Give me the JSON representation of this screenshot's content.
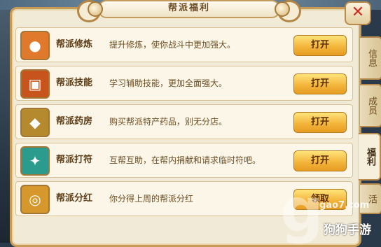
{
  "window": {
    "title": "帮派福利",
    "close_label": "✕"
  },
  "tabs": [
    {
      "label": "信息",
      "active": false
    },
    {
      "label": "成员",
      "active": false
    },
    {
      "label": "福利",
      "active": true
    },
    {
      "label": "活",
      "active": false
    }
  ],
  "rows": [
    {
      "name": "帮派修炼",
      "desc": "提升修炼，使你战斗中更加强大。",
      "button": "打开",
      "icon": "cultivation-icon",
      "icon_color": "#e0792c"
    },
    {
      "name": "帮派技能",
      "desc": "学习辅助技能，更加全面强大。",
      "button": "打开",
      "icon": "skill-book-icon",
      "icon_color": "#c8541d"
    },
    {
      "name": "帮派药房",
      "desc": "购买帮派特产药品，别无分店。",
      "button": "打开",
      "icon": "medicine-icon",
      "icon_color": "#b58a2e"
    },
    {
      "name": "帮派打符",
      "desc": "互帮互助，在帮内捐献和请求临时符吧。",
      "button": "打开",
      "icon": "talisman-icon",
      "icon_color": "#2a9b8c"
    },
    {
      "name": "帮派分红",
      "desc": "你分得上周的帮派分红",
      "button": "领取",
      "icon": "coins-icon",
      "icon_color": "#d6982c"
    }
  ],
  "watermark": {
    "logo_letter": "g",
    "site": "gao7.com",
    "brand": "狗狗手游"
  },
  "colors": {
    "panel_bg": "#f1ead6",
    "border": "#c79b55",
    "button": "#f2b238",
    "close": "#d22b1c"
  }
}
